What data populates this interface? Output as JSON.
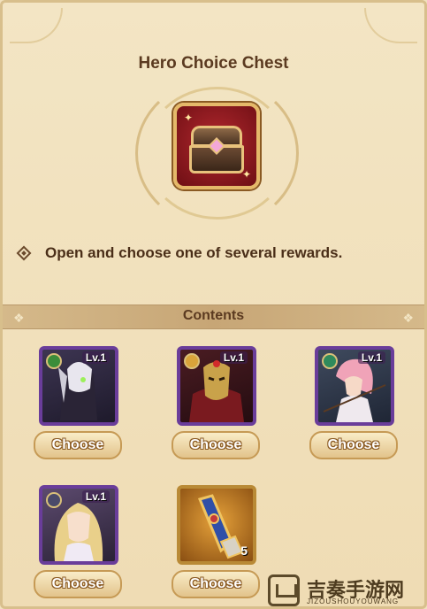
{
  "dialog": {
    "title": "Hero Choice Chest",
    "description": "Open and choose one of several rewards.",
    "section_label": "Contents"
  },
  "items": [
    {
      "level": "Lv.1",
      "button": "Choose",
      "faction": "forest-icon",
      "frame": "purple"
    },
    {
      "level": "Lv.1",
      "button": "Choose",
      "faction": "sun-icon",
      "frame": "purple"
    },
    {
      "level": "Lv.1",
      "button": "Choose",
      "faction": "leaf-icon",
      "frame": "purple"
    },
    {
      "level": "Lv.1",
      "button": "Choose",
      "faction": "star-icon",
      "frame": "purple"
    },
    {
      "count": "5",
      "button": "Choose",
      "frame": "gold",
      "icon": "gauntlet-icon"
    }
  ],
  "watermark": {
    "cn": "吉奏手游网",
    "en": "JIZOUSHOUYOUWANG"
  },
  "colors": {
    "background": "#f1e1bd",
    "title": "#5b3a20",
    "frame_purple": "#6a3d9a",
    "frame_gold": "#b98a36",
    "button": "#e2c38b"
  }
}
